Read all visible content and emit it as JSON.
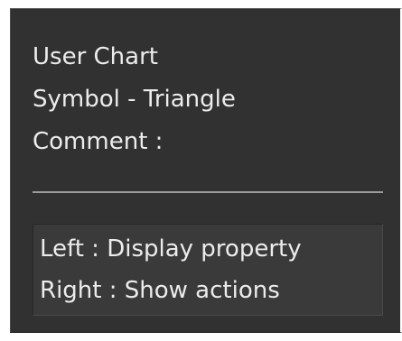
{
  "tooltip": {
    "object_type": "User Chart",
    "symbol": "Symbol - Triangle",
    "comment": "Comment :"
  },
  "hints": {
    "left_click": "Left : Display property",
    "right_click": "Right : Show actions"
  },
  "colors": {
    "panel_background": "#313131",
    "hint_background": "#3a3a3a",
    "text": "#ececec",
    "divider": "#9c9c9c"
  }
}
